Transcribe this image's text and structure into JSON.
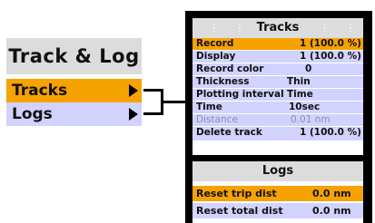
{
  "left_menu": {
    "title": "Track & Log",
    "items": [
      {
        "label": "Tracks",
        "selected": true
      },
      {
        "label": "Logs",
        "selected": false
      }
    ]
  },
  "tracks": {
    "title": "Tracks",
    "rows": [
      {
        "label": "Record",
        "value": "1 (100.0 %)",
        "highlighted": true
      },
      {
        "label": "Display",
        "value": "1 (100.0 %)"
      },
      {
        "label": "Record color",
        "value": "0"
      },
      {
        "label": "Thickness",
        "value": "Thin"
      },
      {
        "label": "Plotting interval",
        "value": "Time"
      },
      {
        "label": "Time",
        "value": "10sec"
      },
      {
        "label": "Distance",
        "value": "0.01  nm",
        "disabled": true
      },
      {
        "label": "Delete track",
        "value": "1 (100.0 %)"
      }
    ]
  },
  "logs": {
    "title": "Logs",
    "rows": [
      {
        "label": "Reset trip dist",
        "value": "0.0 nm",
        "highlighted": true
      },
      {
        "label": "Reset total dist",
        "value": "0.0 nm"
      }
    ]
  },
  "colors": {
    "highlight": "#f6a200",
    "row_bg": "#d2d2ff",
    "header_bg": "#dcdcdc"
  }
}
